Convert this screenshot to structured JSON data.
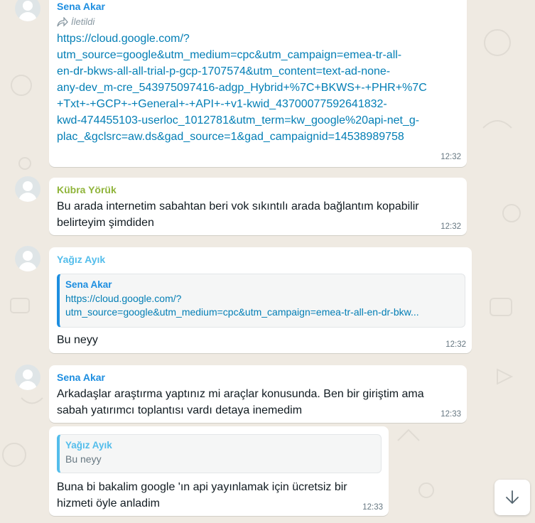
{
  "colors": {
    "background": "#efeae2",
    "sena": "#1d8ee0",
    "kubra": "#8fb43a",
    "yagiz": "#53bdeb",
    "link": "#027eb5",
    "time": "#667781"
  },
  "messages": [
    {
      "sender": "Sena Akar",
      "forwarded_label": "İletildi",
      "link_lines": [
        "https://cloud.google.com/?",
        "utm_source=google&utm_medium=cpc&utm_campaign=emea-tr-all-",
        "en-dr-bkws-all-all-trial-p-gcp-1707574&utm_content=text-ad-none-",
        "any-dev_m-cre_543975097416-adgp_Hybrid+%7C+BKWS+-+PHR+%7C",
        "+Txt+-+GCP+-+General+-+API+-+v1-kwid_43700077592641832-",
        "kwd-474455103-userloc_1012781&utm_term=kw_google%20api-net_g-",
        "plac_&gclsrc=aw.ds&gad_source=1&gad_campaignid=14538989758"
      ],
      "time": "12:32"
    },
    {
      "sender": "Kübra Yörük",
      "text_lines": [
        "Bu arada internetim sabahtan beri vok sıkıntılı arada bağlantım kopabilir",
        "belirteyim şimdiden"
      ],
      "time": "12:32"
    },
    {
      "sender": "Yağız Ayık",
      "quote": {
        "sender": "Sena Akar",
        "line1": "https://cloud.google.com/?",
        "line2": "utm_source=google&utm_medium=cpc&utm_campaign=emea-tr-all-en-dr-bkw..."
      },
      "text": "Bu neyy",
      "time": "12:32"
    },
    {
      "sender": "Sena Akar",
      "text_lines": [
        "Arkadaşlar araştırma yaptınız mi araçlar konusunda. Ben bir giriştim ama",
        "sabah yatırımcı toplantısı vardı detaya inemedim"
      ],
      "time": "12:33"
    },
    {
      "quote": {
        "sender": "Yağız Ayık",
        "line1": "Bu neyy"
      },
      "text_lines": [
        "Buna bi bakalim google 'ın api yayınlamak için ücretsiz bir",
        "hizmeti öyle anladim"
      ],
      "time": "12:33"
    }
  ],
  "scroll_button": {
    "icon": "arrow-down-icon"
  }
}
